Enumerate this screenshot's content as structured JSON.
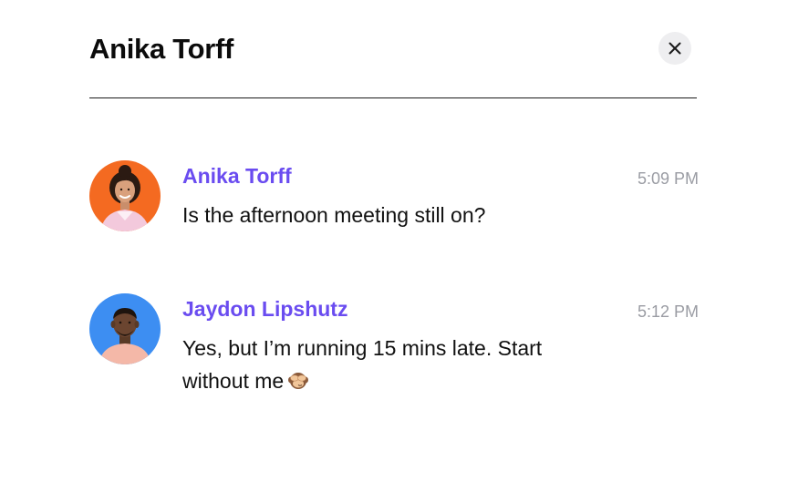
{
  "header": {
    "title": "Anika Torff",
    "close_icon": "close-icon"
  },
  "messages": [
    {
      "sender": "Anika Torff",
      "time": "5:09 PM",
      "text": "Is the afternoon meeting still on?",
      "avatar_bg": "#f46a21"
    },
    {
      "sender": "Jaydon Lipshutz",
      "time": "5:12 PM",
      "text": "Yes, but I’m running 15 mins late. Start without me",
      "emoji": "see-no-evil-monkey-icon",
      "avatar_bg": "#3d8ef2"
    }
  ],
  "colors": {
    "sender_name": "#6a4cf0",
    "timestamp": "#9a9ca3",
    "close_button_bg": "#eeeef0"
  }
}
